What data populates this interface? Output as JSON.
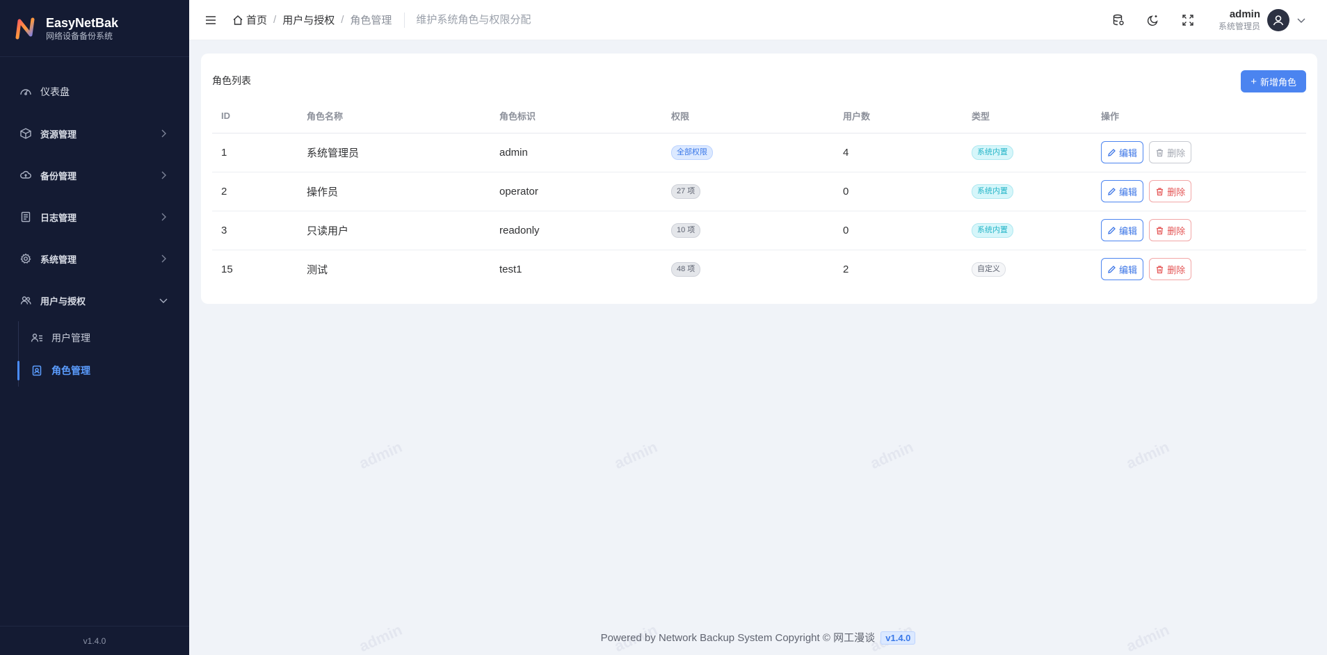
{
  "brand": {
    "name": "EasyNetBak",
    "subtitle": "网络设备备份系统",
    "version": "v1.4.0"
  },
  "sidebar": {
    "items": [
      {
        "label": "仪表盘",
        "icon": "dashboard-icon"
      },
      {
        "label": "资源管理",
        "icon": "cube-icon"
      },
      {
        "label": "备份管理",
        "icon": "cloud-upload-icon"
      },
      {
        "label": "日志管理",
        "icon": "log-icon"
      },
      {
        "label": "系统管理",
        "icon": "gear-icon"
      },
      {
        "label": "用户与授权",
        "icon": "users-icon",
        "expanded": true
      }
    ],
    "subitems": [
      {
        "label": "用户管理",
        "icon": "user-list-icon"
      },
      {
        "label": "角色管理",
        "icon": "badge-icon",
        "active": true
      }
    ]
  },
  "header": {
    "breadcrumbs": [
      "首页",
      "用户与授权",
      "角色管理"
    ],
    "description": "维护系统角色与权限分配",
    "user_name": "admin",
    "user_role": "系统管理员"
  },
  "card": {
    "title": "角色列表",
    "add_label": "新增角色"
  },
  "table": {
    "columns": [
      "ID",
      "角色名称",
      "角色标识",
      "权限",
      "用户数",
      "类型",
      "操作"
    ],
    "rows": [
      {
        "id": "1",
        "name": "系统管理员",
        "key": "admin",
        "perm": "全部权限",
        "users": "4",
        "type": "系统内置",
        "edit": "编辑",
        "del": "删除"
      },
      {
        "id": "2",
        "name": "操作员",
        "key": "operator",
        "perm": "27 项",
        "users": "0",
        "type": "系统内置",
        "edit": "编辑",
        "del": "删除"
      },
      {
        "id": "3",
        "name": "只读用户",
        "key": "readonly",
        "perm": "10 项",
        "users": "0",
        "type": "系统内置",
        "edit": "编辑",
        "del": "删除"
      },
      {
        "id": "15",
        "name": "测试",
        "key": "test1",
        "perm": "48 项",
        "users": "2",
        "type": "自定义",
        "edit": "编辑",
        "del": "删除"
      }
    ]
  },
  "footer": {
    "text": "Powered by Network Backup System Copyright © 网工漫谈",
    "version": "v1.4.0"
  },
  "watermark": "admin",
  "colors": {
    "sidebar_bg": "#141b33",
    "accent": "#4b84f0",
    "danger": "#e45555"
  }
}
